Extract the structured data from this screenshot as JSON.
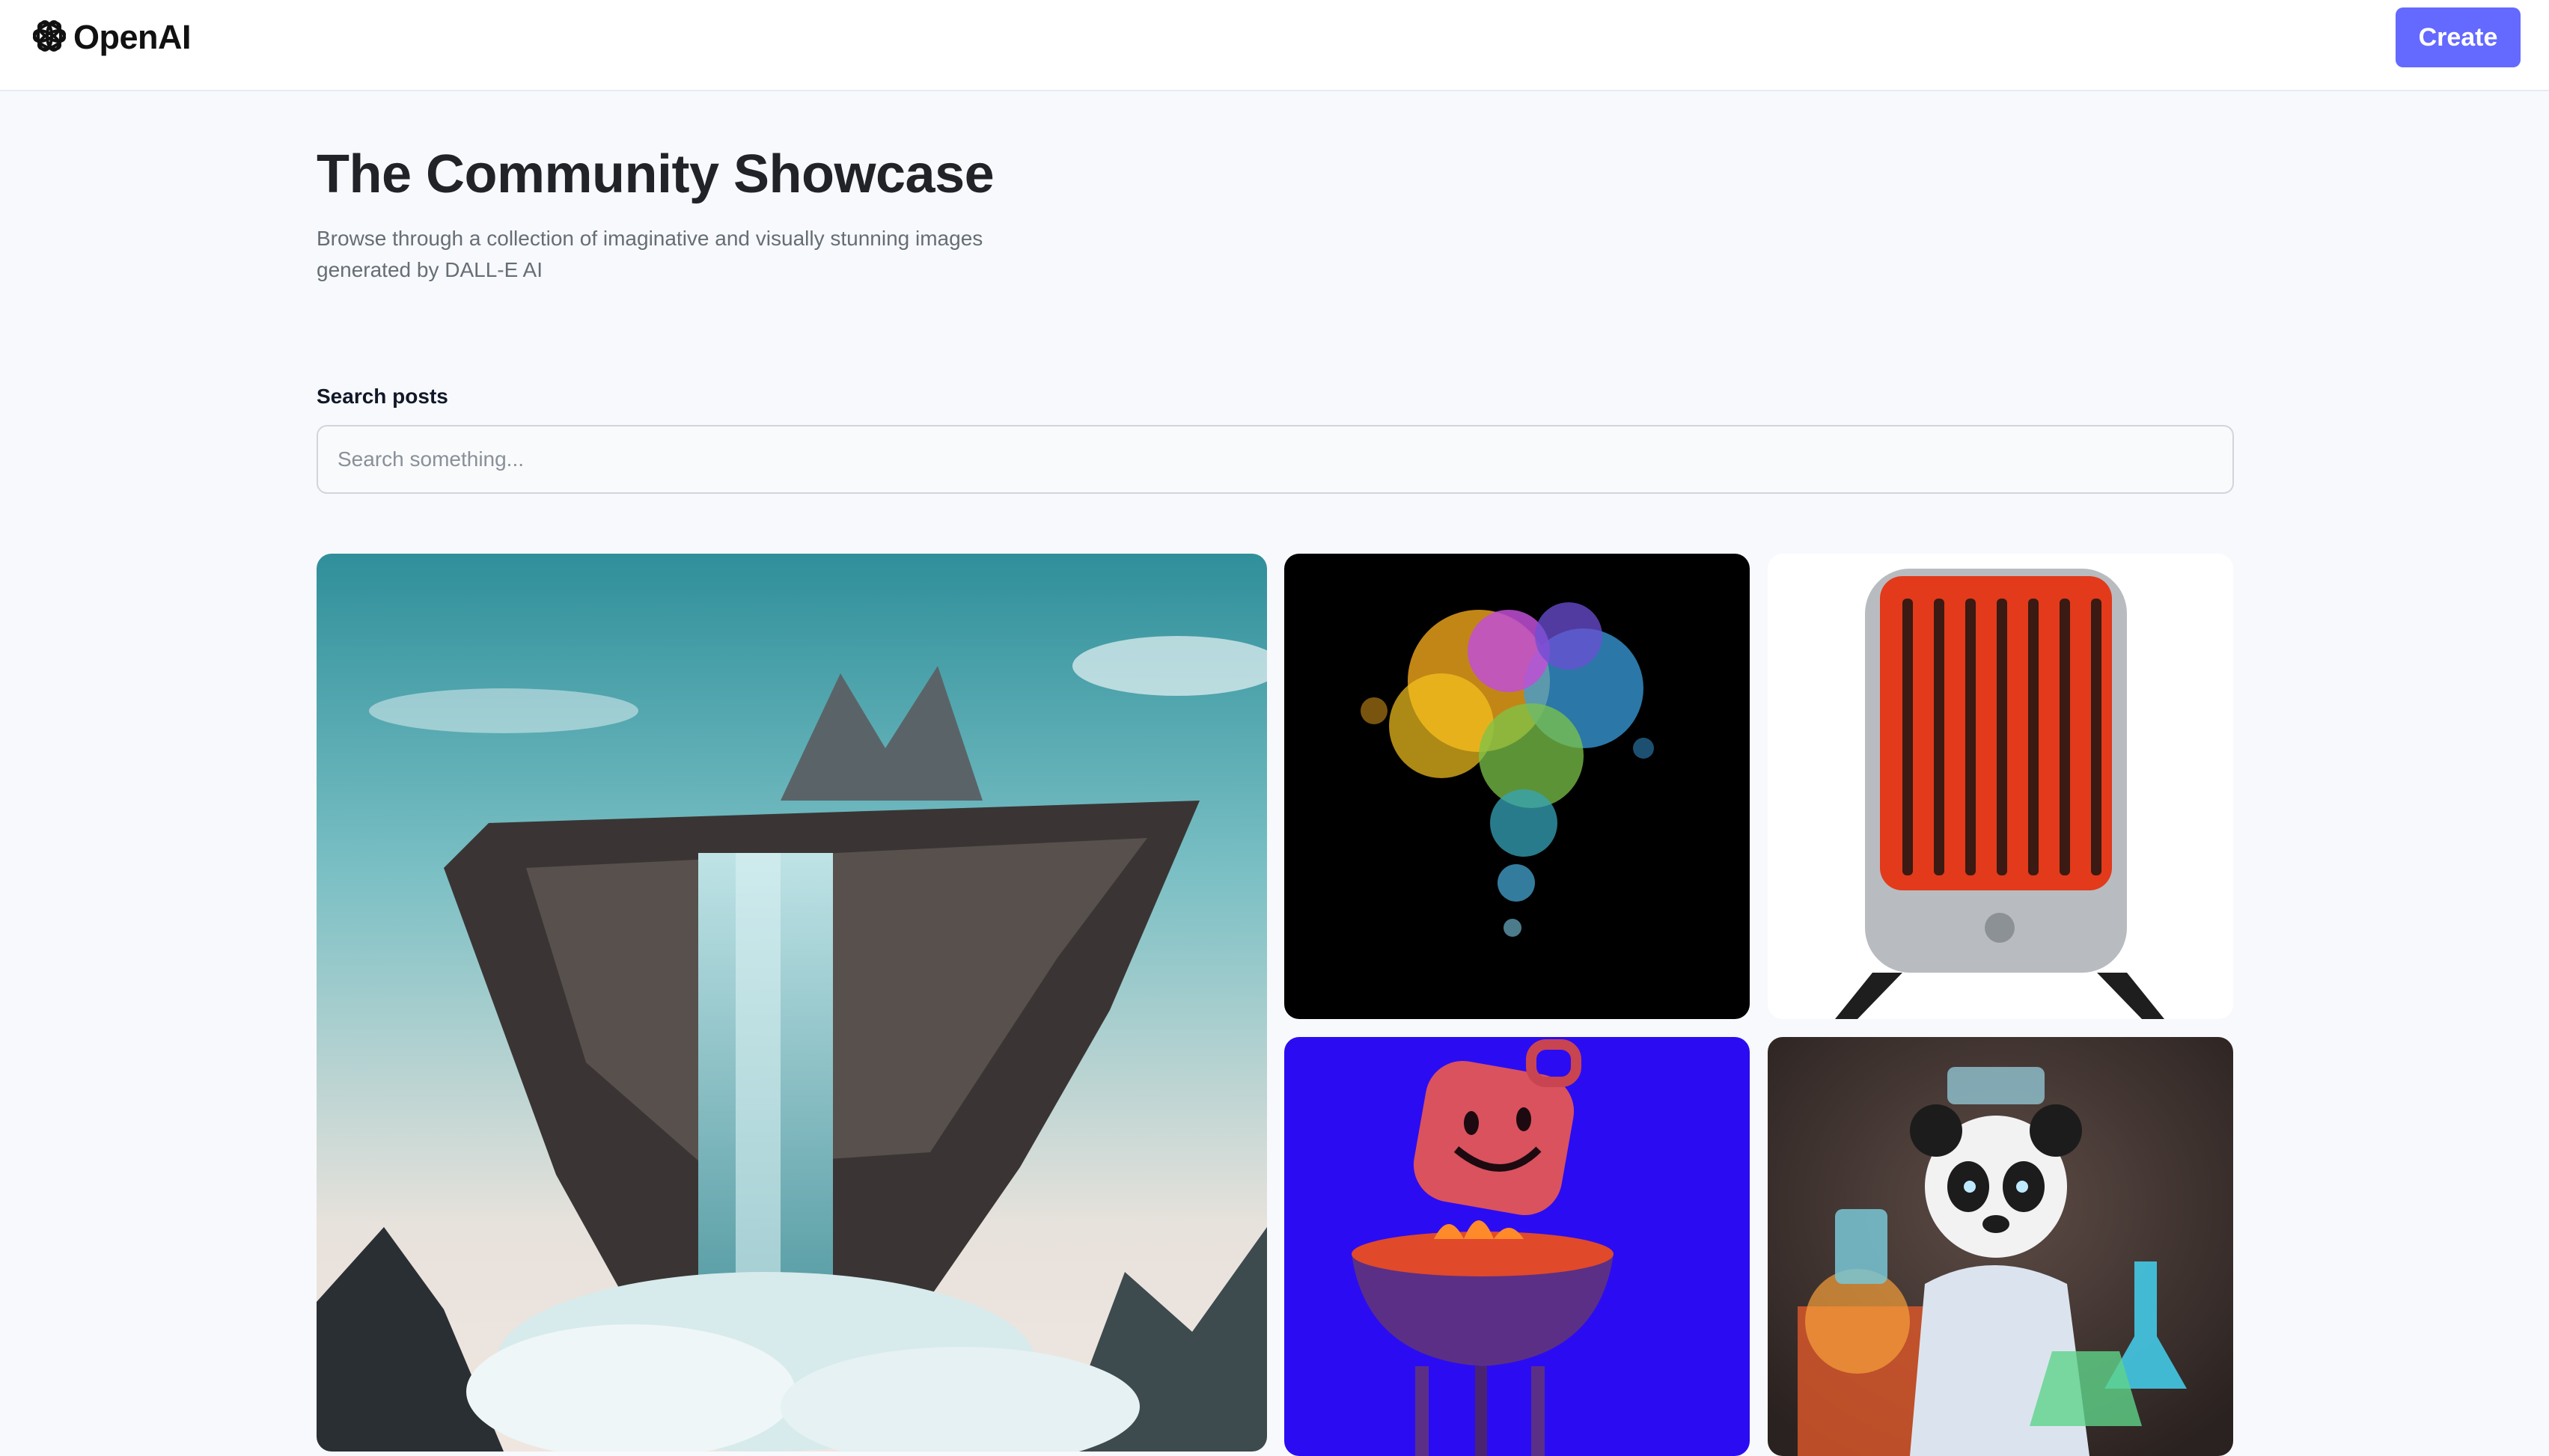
{
  "header": {
    "brand_name": "OpenAI",
    "logo_icon": "openai-logo-icon",
    "create_label": "Create"
  },
  "hero": {
    "title": "The Community Showcase",
    "subtitle": "Browse through a collection of imaginative and visually stunning images generated by DALL-E AI"
  },
  "search": {
    "label": "Search posts",
    "placeholder": "Search something...",
    "value": ""
  },
  "gallery": {
    "cards": [
      {
        "subject": "floating-island-waterfall-image"
      },
      {
        "subject": "color-powder-explosion-image"
      },
      {
        "subject": "red-space-heater-image"
      },
      {
        "subject": "smiling-grill-character-image"
      },
      {
        "subject": "panda-scientist-image"
      }
    ]
  },
  "colors": {
    "accent": "#6469ff",
    "page_background": "#f8f9fc",
    "title_text": "#222328",
    "subtitle_text": "#666e75"
  }
}
